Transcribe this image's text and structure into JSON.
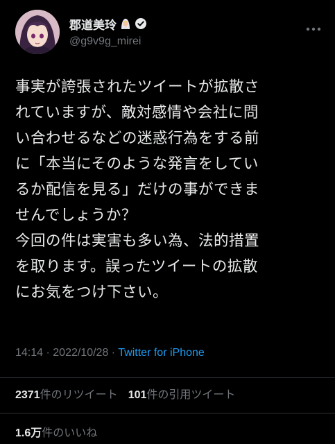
{
  "author": {
    "display_name": "郡道美玲",
    "handle": "@g9v9g_mirei",
    "name_emoji": "person-with-veil-emoji",
    "verified_badge": "verified-icon"
  },
  "tweet": {
    "lines": [
      "事実が誇張されたツイートが拡散さ",
      "れていますが、敵対感情や会社に問",
      "い合わせるなどの迷惑行為をする前",
      "に「本当にそのような発言をしてい",
      "るか配信を見る」だけの事ができま",
      "せんでしょうか？",
      "今回の件は実害も多い為、法的措置",
      "を取ります。誤ったツイートの拡散",
      "にお気をつけ下さい。"
    ]
  },
  "meta": {
    "time": "14:14",
    "separator": " · ",
    "date": "2022/10/28",
    "source": "Twitter for iPhone"
  },
  "stats": {
    "retweets_count": "2371",
    "retweets_label": "件のリツイート",
    "quotes_count": "101",
    "quotes_label": "件の引用ツイート",
    "likes_count": "1.6万",
    "likes_label": "件のいいね"
  },
  "colors": {
    "background": "#000000",
    "text": "#e7e9ea",
    "muted": "#71767b",
    "link": "#1d9bf0",
    "divider": "#2f3336"
  }
}
